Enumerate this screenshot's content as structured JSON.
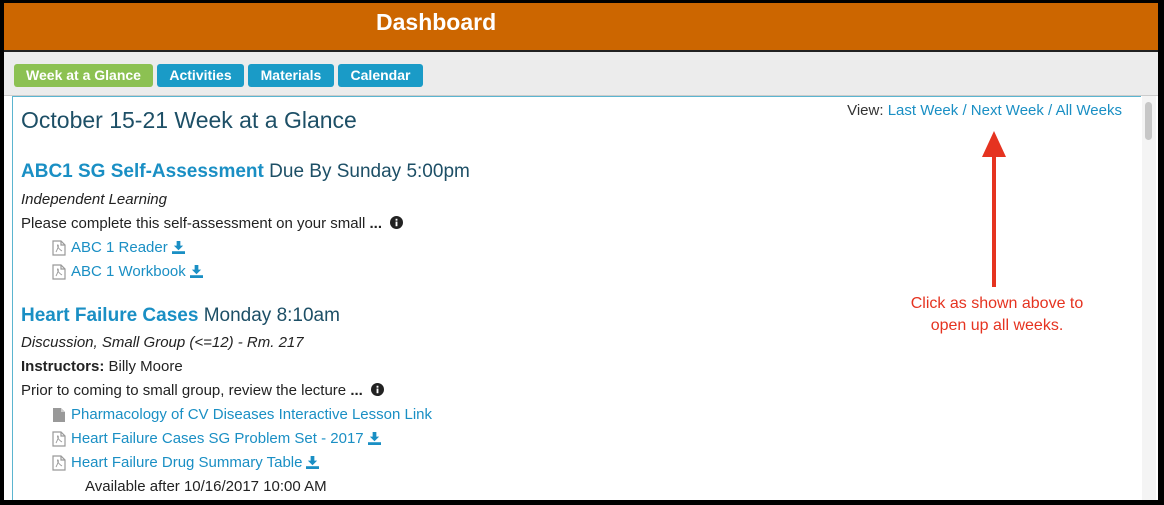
{
  "header": {
    "title": "Dashboard"
  },
  "tabs": [
    {
      "label": "Week at a Glance",
      "active": true
    },
    {
      "label": "Activities",
      "active": false
    },
    {
      "label": "Materials",
      "active": false
    },
    {
      "label": "Calendar",
      "active": false
    }
  ],
  "page": {
    "title": "October 15-21 Week at a Glance",
    "view_label": "View:",
    "view_links": [
      "Last Week",
      "Next Week",
      "All Weeks"
    ],
    "view_sep": " / "
  },
  "events": [
    {
      "name": "ABC1 SG Self-Assessment",
      "when": "Due By Sunday 5:00pm",
      "type": "Independent Learning",
      "description": "Please complete this self-assessment on your small",
      "ellipsis": "...",
      "resources": [
        {
          "label": "ABC 1 Reader",
          "icon": "pdf-icon",
          "download": true
        },
        {
          "label": "ABC 1 Workbook",
          "icon": "pdf-icon",
          "download": true
        }
      ]
    },
    {
      "name": "Heart Failure Cases",
      "when": "Monday 8:10am",
      "type": "Discussion, Small Group (<=12) - Rm. 217",
      "instructors_label": "Instructors:",
      "instructors": "Billy Moore",
      "description": "Prior to coming to small group, review the lecture",
      "ellipsis": "...",
      "resources": [
        {
          "label": "Pharmacology of CV Diseases Interactive Lesson Link",
          "icon": "document-icon",
          "download": false
        },
        {
          "label": "Heart Failure Cases SG Problem Set - 2017",
          "icon": "pdf-icon",
          "download": true
        },
        {
          "label": "Heart Failure Drug Summary Table",
          "icon": "pdf-icon",
          "download": true
        }
      ],
      "availability": "Available after 10/16/2017 10:00 AM"
    }
  ],
  "annotation": {
    "line1": "Click as shown above to",
    "line2": "open up all weeks."
  },
  "colors": {
    "header": "#cc6600",
    "tab": "#1a9bc7",
    "tab_active": "#8cc152",
    "link": "#1a8fc4",
    "annotation": "#e53320"
  }
}
